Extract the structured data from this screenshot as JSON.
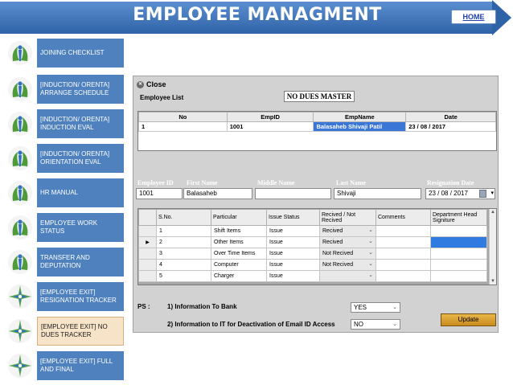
{
  "header": {
    "title": "EMPLOYEE MANAGMENT",
    "home_link": "HOME"
  },
  "sidebar": {
    "items": [
      {
        "label": "JOINING CHECKLIST",
        "active": false,
        "icon": "leaf-figure-icon"
      },
      {
        "label": "[INDUCTION/ ORENTA] ARRANGE SCHEDULE",
        "active": false,
        "icon": "leaf-figure-icon"
      },
      {
        "label": "[INDUCTION/ ORENTA] INDUCTION EVAL",
        "active": false,
        "icon": "leaf-figure-icon"
      },
      {
        "label": "[INDUCTION/ ORENTA] ORIENTATION EVAL",
        "active": false,
        "icon": "leaf-figure-icon"
      },
      {
        "label": "HR MANUAL",
        "active": false,
        "icon": "leaf-figure-icon"
      },
      {
        "label": "EMPLOYEE WORK STATUS",
        "active": false,
        "icon": "leaf-figure-icon"
      },
      {
        "label": "TRANSFER AND DEPUTATION",
        "active": false,
        "icon": "leaf-figure-icon"
      },
      {
        "label": "[EMPLOYEE EXIT] RESIGNATION TRACKER",
        "active": false,
        "icon": "sparkle-figure-icon"
      },
      {
        "label": "[EMPLOYEE EXIT] NO DUES TRACKER",
        "active": true,
        "icon": "sparkle-figure-icon"
      },
      {
        "label": "[EMPLOYEE EXIT] FULL AND FINAL",
        "active": false,
        "icon": "sparkle-figure-icon"
      }
    ]
  },
  "window": {
    "close_label": "Close",
    "employee_list_label": "Employee List",
    "form_title": "NO DUES MASTER"
  },
  "employee_list": {
    "columns": [
      "No",
      "EmpID",
      "EmpName",
      "Date"
    ],
    "rows": [
      {
        "no": "1",
        "emp_id": "1001",
        "emp_name": "Balasaheb  Shivaji Patil",
        "date": "23 / 08 / 2017"
      }
    ]
  },
  "employee_details": {
    "labels": {
      "employee_id": "Employee ID",
      "first_name": "First Name",
      "middle_name": "Middle Name",
      "last_name": "Last Name",
      "resignation_date": "Resignation Date"
    },
    "values": {
      "employee_id": "1001",
      "first_name": "Balasaheb",
      "middle_name": "",
      "last_name": "Shivaji",
      "resignation_date": "23 / 08 / 2017"
    }
  },
  "items_grid": {
    "columns": [
      "S.No.",
      "Particular",
      "Issue Status",
      "Recived / Not Recived",
      "Comments",
      "Department Head Signiture"
    ],
    "rows": [
      {
        "sno": "1",
        "particular": "Shift Items",
        "issue_status": "Issue",
        "received": "Recived",
        "comments": "",
        "signature": ""
      },
      {
        "sno": "2",
        "particular": "Other Items",
        "issue_status": "Issue",
        "received": "Recived",
        "comments": "",
        "signature": ""
      },
      {
        "sno": "3",
        "particular": "Over Time Items",
        "issue_status": "Issue",
        "received": "Not Recived",
        "comments": "",
        "signature": ""
      },
      {
        "sno": "4",
        "particular": "Computer",
        "issue_status": "Issue",
        "received": "Not Recived",
        "comments": "",
        "signature": ""
      },
      {
        "sno": "5",
        "particular": "Charger",
        "issue_status": "Issue",
        "received": "",
        "comments": "",
        "signature": ""
      }
    ],
    "current_row_marker": "▶"
  },
  "ps": {
    "label": "PS :",
    "line1_text": "1)  Information To Bank",
    "line1_value": "YES",
    "line2_text": "2)  Information to IT for Deactivation of Email ID  Access",
    "line2_value": "NO"
  },
  "update_button": "Update",
  "colors": {
    "banner": "#2f63a8",
    "nav_item": "#4e81bd",
    "nav_item_active": "#f7e3c7",
    "selection": "#3a76d6",
    "update_button": "#d89a2c"
  }
}
